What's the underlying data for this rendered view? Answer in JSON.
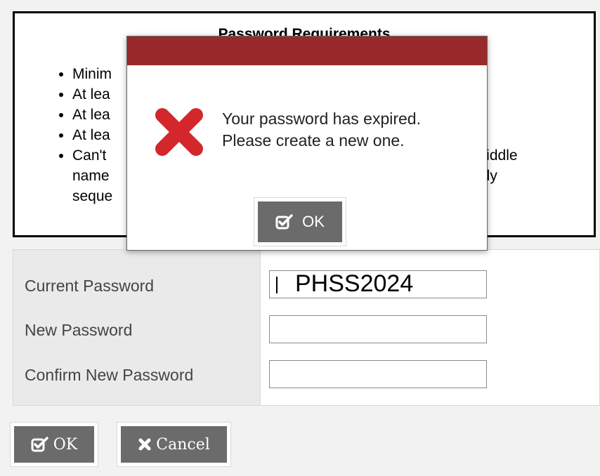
{
  "requirements": {
    "title": "Password Requirements",
    "items": [
      {
        "text": "Minimum"
      },
      {
        "text": "At least"
      },
      {
        "text": "At least"
      },
      {
        "text": "At least"
      },
      {
        "text": "Can't contain your first, middle name, ... only sequential ...",
        "link_text": "",
        "visible_tail_1": "middle",
        "visible_tail_2": "nly"
      }
    ],
    "visible_fragments": {
      "line1": "Minim",
      "line2": "At lea",
      "line3": "At lea",
      "line4": "At lea",
      "line5_start": "Can't",
      "line5_end_link": ",",
      "line5_end": "middle",
      "line6_start": "name",
      "line6_end": "nly",
      "line7_start": "seque"
    }
  },
  "form": {
    "fields": [
      {
        "label": "Current Password",
        "value": "PHSS2024"
      },
      {
        "label": "New Password",
        "value": ""
      },
      {
        "label": "Confirm New Password",
        "value": ""
      }
    ]
  },
  "buttons": {
    "ok_label": "OK",
    "cancel_label": "Cancel",
    "ok_icon": "checkbox-check-icon",
    "cancel_icon": "x-icon"
  },
  "modal": {
    "header_color": "#992a2c",
    "message_line1": "Your password has expired.",
    "message_line2": "Please create a new one.",
    "icon": "error-x-icon",
    "ok_label": "OK"
  }
}
